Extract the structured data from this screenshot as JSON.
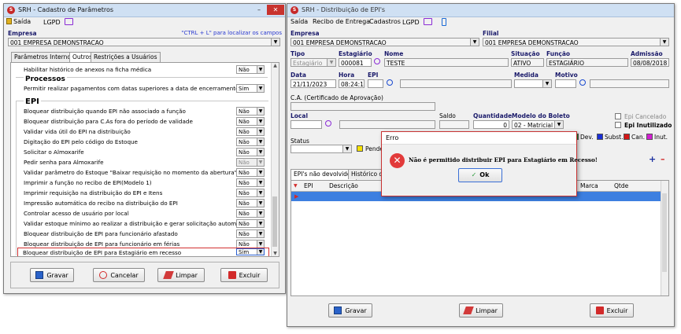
{
  "left_window": {
    "title": "SRH - Cadastro de Parâmetros",
    "menu": {
      "exit": "Saída",
      "lgpd": "LGPD"
    },
    "company_label": "Empresa",
    "hint": "\"CTRL + L\" para localizar os campos",
    "company_value": "001 EMPRESA DEMONSTRACAO",
    "tabs": [
      "Parâmetros Internos",
      "Outros",
      "Restrições a Usuários"
    ],
    "rows": [
      {
        "text": "Habilitar histórico de anexos na ficha médica",
        "value": "Não"
      },
      {
        "text": "Permitir realizar pagamentos com datas superiores a data de encerramento",
        "value": "Sim"
      },
      {
        "text": "Bloquear distribuição quando EPI não associado a função",
        "value": "Não"
      },
      {
        "text": "Bloquear distribuição para C.As fora do período de validade",
        "value": "Não"
      },
      {
        "text": "Validar vida útil do EPI na distribuição",
        "value": "Não"
      },
      {
        "text": "Digitação do EPI pelo código do Estoque",
        "value": "Não"
      },
      {
        "text": "Solicitar o Almoxarife",
        "value": "Não"
      },
      {
        "text": "Pedir senha para Almoxarife",
        "value": "Não"
      },
      {
        "text": "Validar parâmetro do Estoque \"Baixar requisição no momento da abertura\"",
        "value": "Não"
      },
      {
        "text": "Imprimir a função no recibo de EPI(Modelo 1)",
        "value": "Não"
      },
      {
        "text": "Imprimir requisição na distribuição do EPI e Itens",
        "value": "Não"
      },
      {
        "text": "Impressão automática do recibo na distribuição do EPI",
        "value": "Não"
      },
      {
        "text": "Controlar acesso de usuário por local",
        "value": "Não"
      },
      {
        "text": "Validar estoque mínimo ao realizar a distribuição e gerar solicitação automática",
        "value": "Não"
      },
      {
        "text": "Bloquear distribuição de EPI para funcionário afastado",
        "value": "Não"
      },
      {
        "text": "Bloquear distribuição de EPI para funcionário em férias",
        "value": "Não"
      },
      {
        "text": "Bloquear distribuição de EPI para Estagiário em recesso",
        "value": "Sim"
      }
    ],
    "section_processos": "Processos",
    "section_epi": "EPI",
    "buttons": {
      "save": "Gravar",
      "cancel": "Cancelar",
      "clear": "Limpar",
      "delete": "Excluir"
    }
  },
  "right_window": {
    "title": "SRH - Distribuição de EPI's",
    "menu": {
      "exit": "Saída",
      "receipt": "Recibo de Entrega",
      "records": "Cadastros",
      "lgpd": "LGPD"
    },
    "labels": {
      "company": "Empresa",
      "branch": "Filial",
      "type": "Tipo",
      "intern": "Estagiário",
      "name": "Nome",
      "situation": "Situação",
      "role": "Função",
      "admission": "Admissão",
      "date": "Data",
      "time": "Hora",
      "epi": "EPI",
      "measure": "Medida",
      "reason": "Motivo",
      "ca": "C.A. (Certificado de Aprovação)",
      "local": "Local",
      "balance": "Saldo",
      "quantity": "Quantidade",
      "receipt_model": "Modelo do Boleto",
      "status": "Status",
      "epi_cancelled": "Epi Cancelado",
      "epi_unused": "Epi Inutilizado"
    },
    "values": {
      "company": "001 EMPRESA DEMONSTRACAO",
      "branch": "001 EMPRESA DEMONSTRACAO",
      "type": "Estagiário",
      "intern": "000081",
      "name": "TESTE",
      "situation": "ATIVO",
      "role": "ESTAGIÁRIO",
      "admission": "08/08/2018",
      "date": "21/11/2023",
      "time": "08:24:13",
      "quantity": "0",
      "receipt_model": "02 - Matricial"
    },
    "legend": {
      "pending": "Pende",
      "dev": "Dev.",
      "subst": "Subst.",
      "can": "Can.",
      "inut": "Inut."
    },
    "tabs": [
      "EPI's não devolvidos",
      "Histórico das"
    ],
    "grid_headers": [
      "EPI",
      "Descrição",
      "Marca",
      "Qtde"
    ],
    "buttons": {
      "save": "Gravar",
      "clear": "Limpar",
      "delete": "Excluir"
    },
    "colors": {
      "pending": "#f5e100",
      "dev": "#1d8f2a",
      "subst": "#1a2fd6",
      "can": "#d41717",
      "inut": "#d21fd2",
      "grid_selected": "#3d7fe0"
    }
  },
  "dialog": {
    "title": "Erro",
    "message": "Não é permitido distribuir EPI para Estagiário em Recesso!",
    "ok": "Ok"
  }
}
